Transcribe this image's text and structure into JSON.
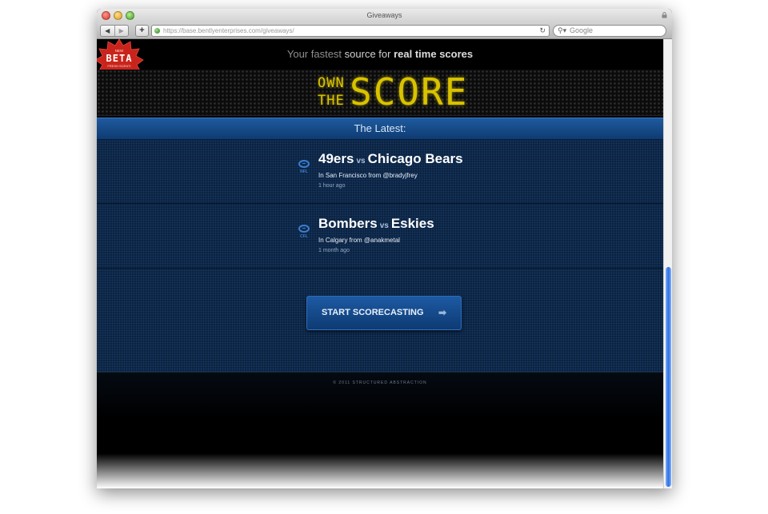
{
  "window": {
    "title": "Giveaways"
  },
  "toolbar": {
    "back": "◀",
    "forward": "▶",
    "add": "+",
    "url": "https://base.bentlyenterprises.com/giveaways/",
    "reload": "↻",
    "search_placeholder": "Google"
  },
  "badge": {
    "top": "NEW",
    "main": "BETA",
    "bottom": "FRESH SCENT!"
  },
  "tagline": {
    "prefix": "Your fastest",
    "middle": "source for",
    "strong": "real time scores"
  },
  "scoreboard": {
    "own": "OWN",
    "the": "THE",
    "score": "SCORE"
  },
  "latest": {
    "label": "The Latest:"
  },
  "games": [
    {
      "league": "NFL",
      "team1": "49ers",
      "vs": "vs",
      "team2": "Chicago Bears",
      "location": "In San Francisco from @bradyjfrey",
      "time": "1 hour ago"
    },
    {
      "league": "CFL",
      "team1": "Bombers",
      "vs": "vs",
      "team2": "Eskies",
      "location": "In Calgary from @anakmetal",
      "time": "1 month ago"
    }
  ],
  "cta": {
    "label": "START SCORECASTING",
    "arrow": "➡"
  },
  "footer": {
    "copyright": "© 2011 STRUCTURED ABSTRACTION"
  },
  "colors": {
    "scoreboard_yellow": "#d9c300",
    "latest_blue": "#1f5a9e",
    "feed_bg": "#0a2140"
  }
}
